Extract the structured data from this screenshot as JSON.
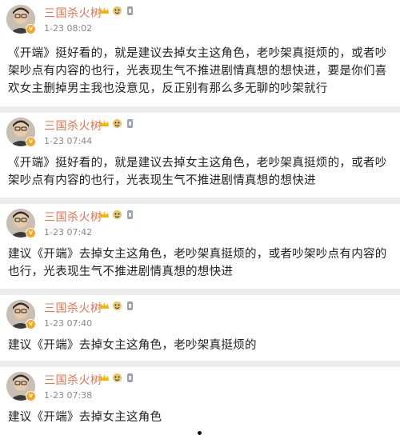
{
  "posts": [
    {
      "username": "三国杀火树",
      "time": "1-23 08:02",
      "text": "《开端》挺好看的，就是建议去掉女主这角色，老吵架真挺烦的，或者吵架吵点有内容的也行，光表现生气不推进剧情真想的想快进，要是你们喜欢女主删掉男主我也没意见，反正别有那么多无聊的吵架就行"
    },
    {
      "username": "三国杀火树",
      "time": "1-23 07:44",
      "text": "《开端》挺好看的，就是建议去掉女主这角色，老吵架真挺烦的，或者吵架吵点有内容的也行，光表现生气不推进剧情真想的想快进"
    },
    {
      "username": "三国杀火树",
      "time": "1-23 07:42",
      "text": "建议《开端》去掉女主这角色，老吵架真挺烦的，或者吵架吵点有内容的也行，光表现生气不推进剧情真想的想快进"
    },
    {
      "username": "三国杀火树",
      "time": "1-23 07:40",
      "text": "建议《开端》去掉女主这角色，老吵架真挺烦的"
    },
    {
      "username": "三国杀火树",
      "time": "1-23 07:38",
      "text": "建议《开端》去掉女主这角色"
    }
  ],
  "colors": {
    "username": "#eb7350",
    "time": "#888888",
    "text": "#222222",
    "background": "#ececec",
    "card": "#ffffff"
  },
  "icons": [
    "avatar",
    "verified-badge-icon",
    "crown-icon",
    "emoji-badge-icon",
    "medal-icon"
  ]
}
